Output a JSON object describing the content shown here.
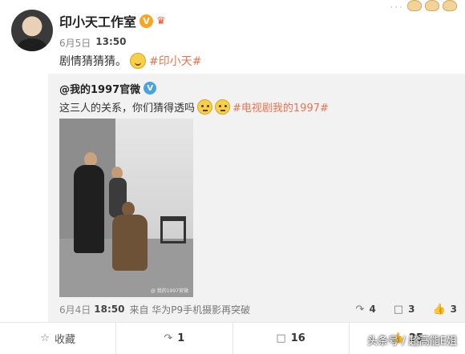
{
  "post": {
    "author": "印小天工作室",
    "verified_mark": "V",
    "vip_mark": "ᵛ",
    "date": "6月5日",
    "time": "13:50",
    "text": "剧情猜猜猜。",
    "topic": "#印小天#"
  },
  "repost": {
    "author": "@我的1997官微",
    "verified_mark": "V",
    "text": "这三人的关系，你们猜得透吗",
    "topic": "#电视剧我的1997#",
    "date": "6月4日",
    "time": "18:50",
    "source": "来自 华为P9手机摄影再突破",
    "reposts": "4",
    "comments": "3",
    "likes": "3",
    "photo_watermark": "@ 我的1997官微"
  },
  "bar": {
    "favorite_label": "收藏",
    "reposts": "1",
    "comments": "16",
    "likes": "25"
  },
  "brand": "头条号 / 超高能E姐",
  "icons": {
    "favorite": "star-icon",
    "repost": "repost-icon",
    "comment": "comment-icon",
    "like": "thumbs-up-icon"
  }
}
